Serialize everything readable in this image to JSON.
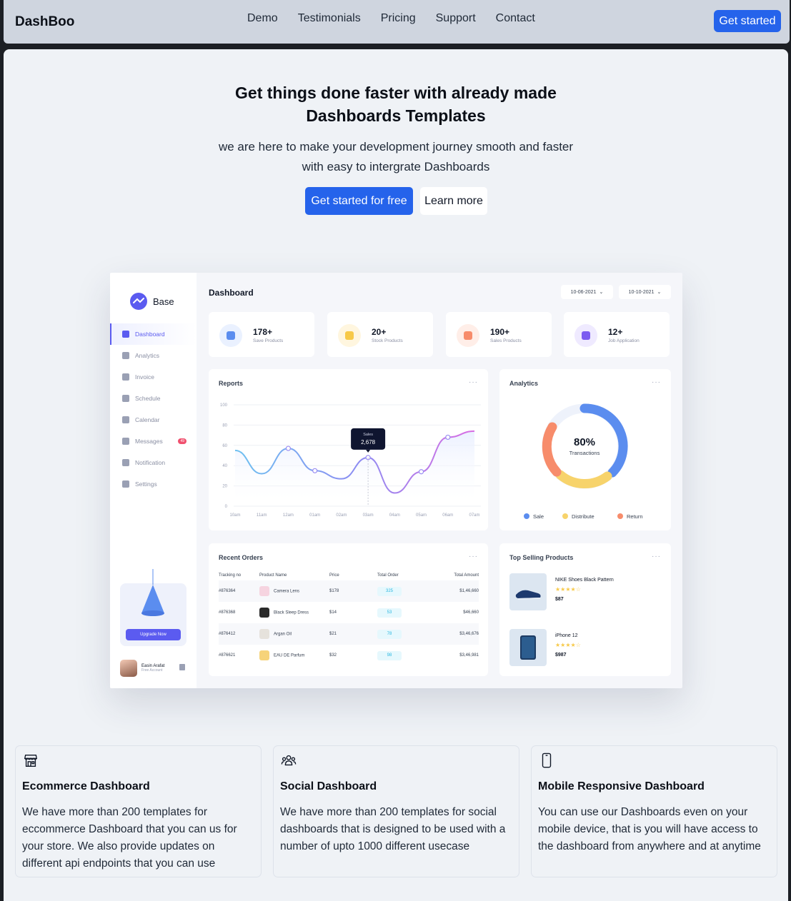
{
  "navbar": {
    "brand": "DashBoo",
    "links": [
      "Demo",
      "Testimonials",
      "Pricing",
      "Support",
      "Contact"
    ],
    "cta": "Get started"
  },
  "hero": {
    "title_line1": "Get things done faster with already made",
    "title_line2": "Dashboards Templates",
    "subtitle_line1": "we are here to make your development journey smooth and faster",
    "subtitle_line2": "with easy to intergrate Dashboards",
    "primary_button": "Get started for free",
    "secondary_button": "Learn more"
  },
  "preview": {
    "logo": "Base",
    "page_title": "Dashboard",
    "date_from": "10-06-2021",
    "date_to": "10-10-2021",
    "menu": [
      {
        "label": "Dashboard",
        "active": true
      },
      {
        "label": "Analytics"
      },
      {
        "label": "Invoice"
      },
      {
        "label": "Schedule"
      },
      {
        "label": "Calendar"
      },
      {
        "label": "Messages",
        "badge": "49"
      },
      {
        "label": "Notification"
      },
      {
        "label": "Settings"
      }
    ],
    "upgrade_button": "Upgrade Now",
    "user": {
      "name": "Easin Arafat",
      "role": "Free Account"
    },
    "stats": [
      {
        "value": "178+",
        "label": "Save Products",
        "color": "#5b8def",
        "bg": "#eaf1ff"
      },
      {
        "value": "20+",
        "label": "Stock Products",
        "color": "#f7c948",
        "bg": "#fff6df"
      },
      {
        "value": "190+",
        "label": "Sales Products",
        "color": "#f78c6b",
        "bg": "#ffeee8"
      },
      {
        "value": "12+",
        "label": "Job Application",
        "color": "#7b5bf0",
        "bg": "#efeaff"
      }
    ],
    "reports": {
      "title": "Reports",
      "tooltip_label": "Sales",
      "tooltip_value": "2,678"
    },
    "analytics": {
      "title": "Analytics",
      "center_value": "80%",
      "center_label": "Transactions",
      "legend": [
        {
          "label": "Sale",
          "color": "#5b8def"
        },
        {
          "label": "Distribute",
          "color": "#f7d36b"
        },
        {
          "label": "Return",
          "color": "#f78c6b"
        }
      ]
    },
    "orders": {
      "title": "Recent Orders",
      "headers": [
        "Tracking no",
        "Product Name",
        "Price",
        "Total Order",
        "Total Amount"
      ],
      "rows": [
        {
          "tracking": "#876364",
          "product": "Camera Lens",
          "price": "$178",
          "total": "325",
          "amount": "$1,46,660"
        },
        {
          "tracking": "#876368",
          "product": "Black Sleep Dress",
          "price": "$14",
          "total": "53",
          "amount": "$46,660"
        },
        {
          "tracking": "#876412",
          "product": "Argan Oil",
          "price": "$21",
          "total": "78",
          "amount": "$3,46,676"
        },
        {
          "tracking": "#876621",
          "product": "EAU DE Parfum",
          "price": "$32",
          "total": "98",
          "amount": "$3,46,981"
        }
      ]
    },
    "top_selling": {
      "title": "Top Selling Products",
      "items": [
        {
          "name": "NIKE Shoes Black Pattern",
          "price": "$87",
          "stars": "★★★★☆"
        },
        {
          "name": "iPhone 12",
          "price": "$987",
          "stars": "★★★★☆"
        }
      ]
    }
  },
  "chart_data": {
    "type": "line",
    "title": "Reports",
    "x": [
      "10am",
      "11am",
      "12am",
      "01am",
      "02am",
      "03am",
      "04am",
      "05am",
      "06am",
      "07am"
    ],
    "y_ticks": [
      "100",
      "80",
      "60",
      "40",
      "20",
      "0"
    ],
    "ylim": [
      0,
      100
    ],
    "series": [
      {
        "values": [
          55,
          32,
          57,
          35,
          27,
          48,
          13,
          34,
          68,
          74
        ]
      }
    ]
  },
  "features": [
    {
      "icon": "storefront-icon",
      "title": "Ecommerce Dashboard",
      "description": "We have more than 200 templates for eccommerce Dashboard that you can us for your store. We also provide updates on different api endpoints that you can use"
    },
    {
      "icon": "users-group-icon",
      "title": "Social Dashboard",
      "description": "We have more than 200 templates for social dashboards that is designed to be used with a number of upto 1000 different usecase"
    },
    {
      "icon": "mobile-phone-icon",
      "title": "Mobile Responsive Dashboard",
      "description": "You can use our Dashboards even on your mobile device, that is you will have access to the dashboard from anywhere and at anytime"
    }
  ]
}
